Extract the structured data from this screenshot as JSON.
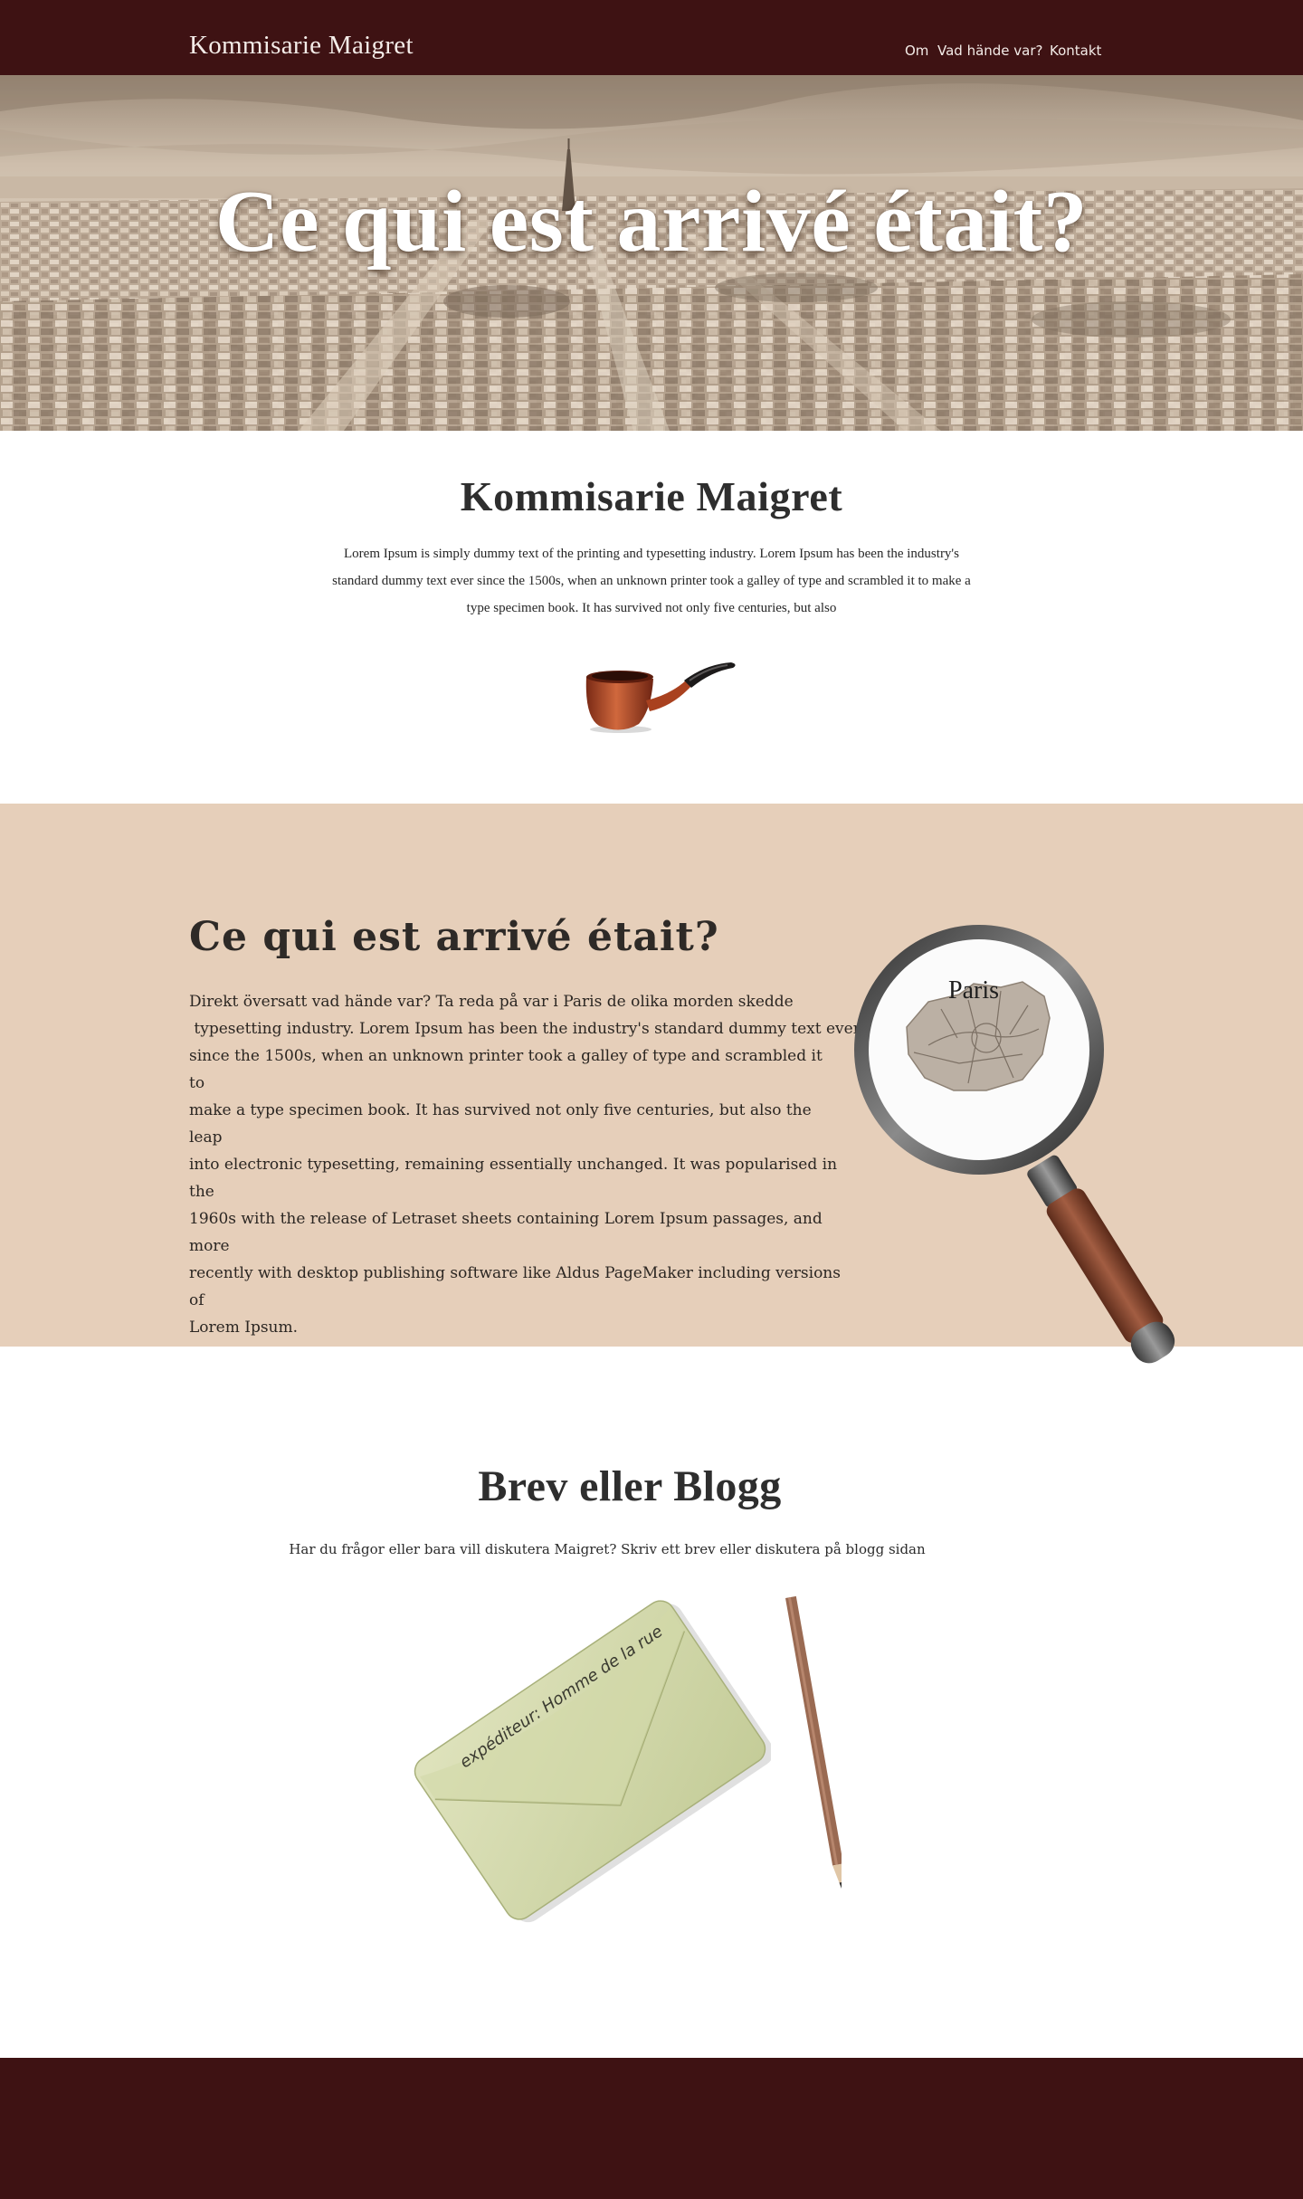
{
  "nav": {
    "brand": "Kommisarie Maigret",
    "items": [
      {
        "label": "Om"
      },
      {
        "label": "Vad hände var?"
      },
      {
        "label": "Kontakt"
      }
    ]
  },
  "hero": {
    "title": "Ce qui est arrivé était?"
  },
  "intro": {
    "title": "Kommisarie Maigret",
    "lines": [
      "Lorem Ipsum is simply dummy text of the printing and typesetting industry. Lorem Ipsum has been the industry's",
      "standard dummy text ever since the 1500s, when an unknown printer took a galley of type and scrambled it to make a",
      "type specimen book. It has survived not only five centuries, but also"
    ]
  },
  "story": {
    "title": "Ce qui est arrivé était?",
    "lines": [
      "Direkt översatt vad hände var?  Ta reda på var i Paris de olika morden skedde",
      " typesetting industry. Lorem Ipsum has been the industry's standard dummy text ever",
      "since the 1500s, when an unknown printer took a galley of type and scrambled it to",
      "make a type specimen book. It has survived not only five centuries, but also the leap",
      "into electronic typesetting, remaining essentially unchanged. It was popularised in the",
      "1960s with the release of Letraset sheets containing Lorem Ipsum passages, and more",
      "recently with desktop publishing software like Aldus PageMaker including versions of",
      "Lorem Ipsum."
    ],
    "map_label": "Paris"
  },
  "blog": {
    "title": "Brev eller Blogg",
    "text": "Har du frågor eller bara vill diskutera Maigret? Skriv ett brev eller diskutera på blogg sidan",
    "envelope_text": "expéditeur: Homme de la rue"
  },
  "colors": {
    "nav_bg": "#3e1213",
    "section_bg": "#e6cfba",
    "footer_bg": "#3e1213"
  }
}
